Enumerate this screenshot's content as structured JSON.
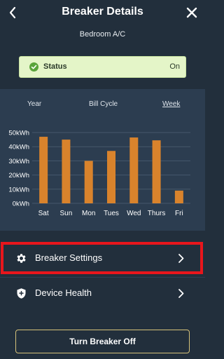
{
  "header": {
    "title": "Breaker Details",
    "subtitle": "Bedroom A/C"
  },
  "status": {
    "label": "Status",
    "value": "On",
    "indicator_color": "#5aa43b"
  },
  "periods": {
    "year": "Year",
    "bill_cycle": "Bill Cycle",
    "week": "Week",
    "selected": "Week"
  },
  "chart_data": {
    "type": "bar",
    "categories": [
      "Sat",
      "Sun",
      "Mon",
      "Tues",
      "Wed",
      "Thurs",
      "Fri"
    ],
    "values": [
      47000,
      45000,
      30000,
      37000,
      46500,
      44500,
      9000
    ],
    "y_ticks": [
      "0kWh",
      "10kWh",
      "20kWh",
      "30kWh",
      "40kWh",
      "50kWh"
    ],
    "ylim": [
      0,
      50000
    ],
    "grid": true,
    "bar_color": "#d9832c"
  },
  "menu": {
    "breaker_settings": "Breaker Settings",
    "device_health": "Device Health"
  },
  "actions": {
    "turn_off": "Turn Breaker Off"
  },
  "colors": {
    "highlight": "#e8161c",
    "accent_border": "#d6c27a"
  }
}
